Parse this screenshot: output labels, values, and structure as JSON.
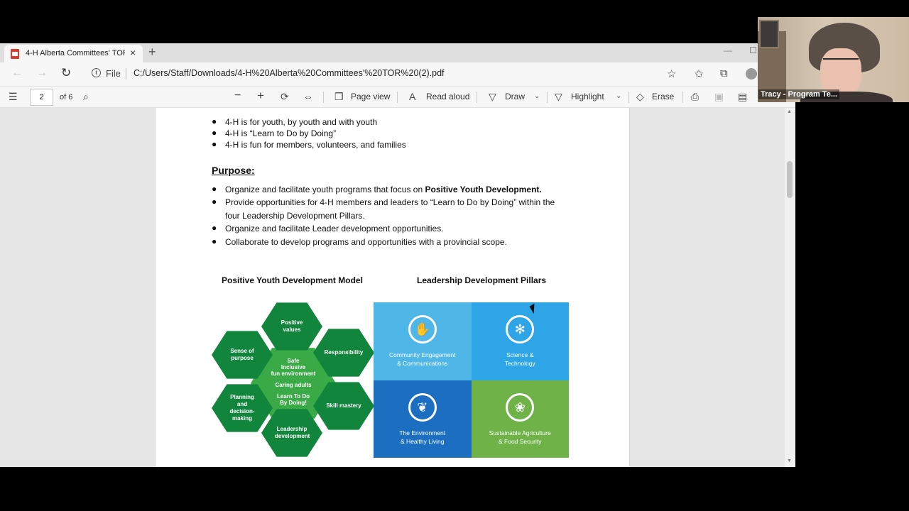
{
  "tab": {
    "title": "4-H Alberta Committees' TOR (2",
    "close": "×",
    "new": "+"
  },
  "address": {
    "scheme_label": "File",
    "url": "C:/Users/Staff/Downloads/4-H%20Alberta%20Committees'%20TOR%20(2).pdf"
  },
  "pdf_toolbar": {
    "page": "2",
    "of": "of 6",
    "zoom_out": "−",
    "zoom_in": "+",
    "page_view": "Page view",
    "read_aloud": "Read aloud",
    "draw": "Draw",
    "highlight": "Highlight",
    "erase": "Erase"
  },
  "document": {
    "top_bullets": [
      "4-H is for youth, by youth and with youth",
      "4-H is “Learn to Do by Doing”",
      "4-H is fun for members, volunteers, and families"
    ],
    "purpose_heading": "Purpose:",
    "purpose_bullets": [
      {
        "text": "Organize and facilitate youth programs that focus on ",
        "bold": "Positive Youth Development."
      },
      {
        "text": "Provide opportunities for 4-H members and leaders to “Learn to Do by Doing” within the"
      },
      {
        "text": "four Leadership Development Pillars."
      },
      {
        "text": "Organize and facilitate Leader development opportunities."
      },
      {
        "text": "Collaborate to develop programs and opportunities with a provincial scope."
      }
    ],
    "pyd_heading": "Positive Youth Development Model",
    "ldp_heading": "Leadership Development Pillars",
    "hexagons": {
      "top": "Positive values",
      "left_upper": "Sense of purpose",
      "right_upper": "Responsibility",
      "left_lower": "Planning and decision-making",
      "right_lower": "Skill mastery",
      "bottom": "Leadership development",
      "center_1": "Safe",
      "center_2": "Inclusive",
      "center_3": "fun environment",
      "center_4": "Caring adults",
      "center_5": "Learn To Do",
      "center_6": "By Doing!"
    },
    "pillars": [
      {
        "label_1": "Community Engagement",
        "label_2": "& Communications",
        "color": "#4fb6e8",
        "icon": "handshake-icon"
      },
      {
        "label_1": "Science &",
        "label_2": "Technology",
        "color": "#2ea5e6",
        "icon": "atom-icon"
      },
      {
        "label_1": "The Environment",
        "label_2": "& Healthy Living",
        "color": "#1c6fc0",
        "icon": "leaf-icon"
      },
      {
        "label_1": "Sustainable Agriculture",
        "label_2": "& Food Security",
        "color": "#6fb248",
        "icon": "wheat-icon"
      }
    ]
  },
  "webcam": {
    "name": "Tracy - Program Te..."
  }
}
